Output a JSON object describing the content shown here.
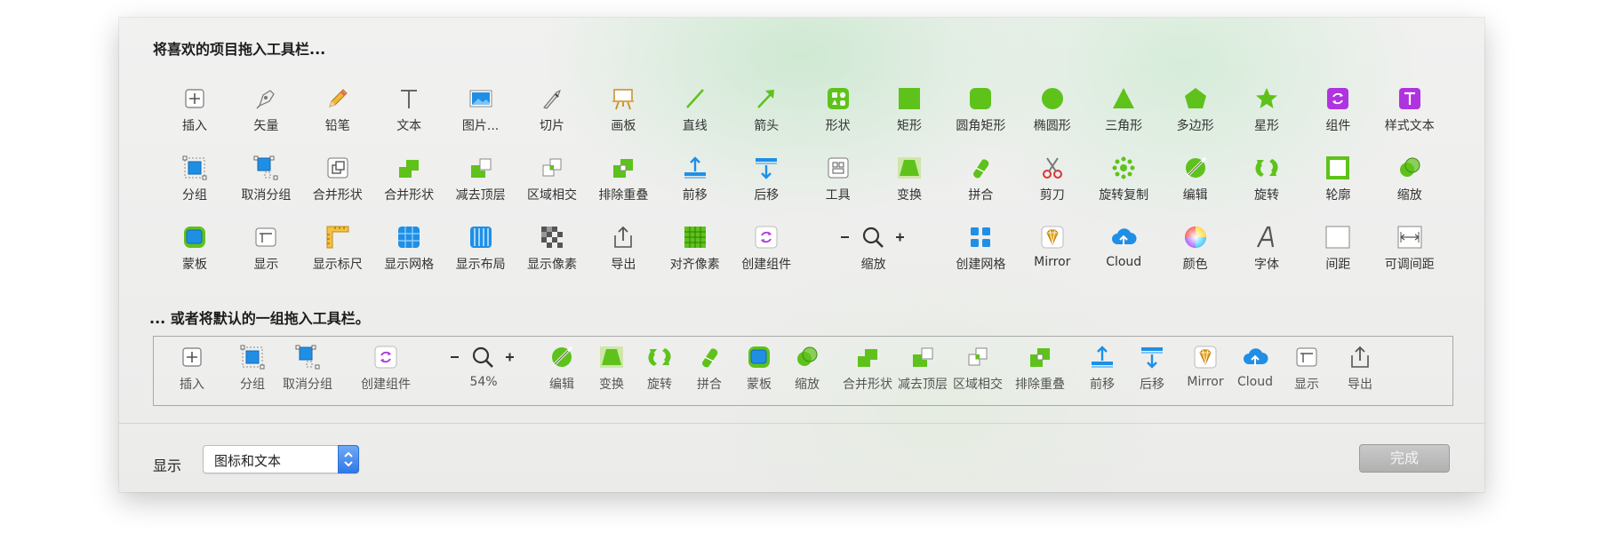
{
  "sheet": {
    "drag_items_heading": "将喜欢的项目拖入工具栏...",
    "default_set_heading": "... 或者将默认的一组拖入工具栏。"
  },
  "palette_rows": [
    [
      {
        "label": "插入",
        "icon": "insert-plus-icon"
      },
      {
        "label": "矢量",
        "icon": "vector-pen-icon"
      },
      {
        "label": "铅笔",
        "icon": "pencil-icon"
      },
      {
        "label": "文本",
        "icon": "text-icon"
      },
      {
        "label": "图片...",
        "icon": "image-icon"
      },
      {
        "label": "切片",
        "icon": "slice-knife-icon"
      },
      {
        "label": "画板",
        "icon": "artboard-easel-icon"
      },
      {
        "label": "直线",
        "icon": "line-icon"
      },
      {
        "label": "箭头",
        "icon": "arrow-icon"
      },
      {
        "label": "形状",
        "icon": "shapes-icon"
      },
      {
        "label": "矩形",
        "icon": "rectangle-icon"
      },
      {
        "label": "圆角矩形",
        "icon": "rounded-rectangle-icon"
      },
      {
        "label": "椭圆形",
        "icon": "oval-icon"
      },
      {
        "label": "三角形",
        "icon": "triangle-icon"
      },
      {
        "label": "多边形",
        "icon": "polygon-icon"
      },
      {
        "label": "星形",
        "icon": "star-icon"
      },
      {
        "label": "组件",
        "icon": "symbol-icon"
      },
      {
        "label": "样式文本",
        "icon": "text-style-icon"
      }
    ],
    [
      {
        "label": "分组",
        "icon": "group-icon"
      },
      {
        "label": "取消分组",
        "icon": "ungroup-icon"
      },
      {
        "label": "合并形状",
        "icon": "combine-shape-icon"
      },
      {
        "label": "合并形状",
        "icon": "union-icon"
      },
      {
        "label": "减去顶层",
        "icon": "subtract-icon"
      },
      {
        "label": "区域相交",
        "icon": "intersect-icon"
      },
      {
        "label": "排除重叠",
        "icon": "difference-icon"
      },
      {
        "label": "前移",
        "icon": "move-forward-icon"
      },
      {
        "label": "后移",
        "icon": "move-backward-icon"
      },
      {
        "label": "工具",
        "icon": "tools-icon"
      },
      {
        "label": "变换",
        "icon": "transform-icon"
      },
      {
        "label": "拼合",
        "icon": "flatten-icon"
      },
      {
        "label": "剪刀",
        "icon": "scissors-icon"
      },
      {
        "label": "旋转复制",
        "icon": "rotate-copies-icon"
      },
      {
        "label": "编辑",
        "icon": "edit-icon"
      },
      {
        "label": "旋转",
        "icon": "rotate-icon"
      },
      {
        "label": "轮廓",
        "icon": "outline-icon"
      },
      {
        "label": "缩放",
        "icon": "scale-icon"
      }
    ],
    [
      {
        "label": "蒙板",
        "icon": "mask-icon"
      },
      {
        "label": "显示",
        "icon": "view-icon"
      },
      {
        "label": "显示标尺",
        "icon": "rulers-icon"
      },
      {
        "label": "显示网格",
        "icon": "grid-icon"
      },
      {
        "label": "显示布局",
        "icon": "layout-icon"
      },
      {
        "label": "显示像素",
        "icon": "pixels-icon"
      },
      {
        "label": "导出",
        "icon": "export-icon"
      },
      {
        "label": "对齐像素",
        "icon": "pixel-align-icon"
      },
      {
        "label": "创建组件",
        "icon": "create-symbol-icon"
      },
      {
        "label": "缩放",
        "icon": "zoom-icon",
        "zoom": true
      },
      {
        "label": "创建网格",
        "icon": "make-grid-icon"
      },
      {
        "label": "Mirror",
        "icon": "mirror-icon"
      },
      {
        "label": "Cloud",
        "icon": "cloud-icon"
      },
      {
        "label": "颜色",
        "icon": "colors-icon"
      },
      {
        "label": "字体",
        "icon": "fonts-icon"
      },
      {
        "label": "间距",
        "icon": "space-icon"
      },
      {
        "label": "可调间距",
        "icon": "flexible-space-icon"
      }
    ]
  ],
  "default_set": [
    {
      "label": "插入",
      "icon": "insert-plus-icon"
    },
    {
      "label": "分组",
      "icon": "group-icon"
    },
    {
      "label": "取消分组",
      "icon": "ungroup-icon"
    },
    {
      "label": "创建组件",
      "icon": "create-symbol-icon"
    },
    {
      "label": "54%",
      "icon": "zoom-icon",
      "zoom": true
    },
    {
      "label": "编辑",
      "icon": "edit-icon"
    },
    {
      "label": "变换",
      "icon": "transform-icon"
    },
    {
      "label": "旋转",
      "icon": "rotate-icon"
    },
    {
      "label": "拼合",
      "icon": "flatten-icon"
    },
    {
      "label": "蒙板",
      "icon": "mask-icon"
    },
    {
      "label": "缩放",
      "icon": "scale-icon"
    },
    {
      "label": "合并形状",
      "icon": "union-icon"
    },
    {
      "label": "减去顶层",
      "icon": "subtract-icon"
    },
    {
      "label": "区域相交",
      "icon": "intersect-icon"
    },
    {
      "label": "排除重叠",
      "icon": "difference-icon"
    },
    {
      "label": "前移",
      "icon": "move-forward-icon"
    },
    {
      "label": "后移",
      "icon": "move-backward-icon"
    },
    {
      "label": "Mirror",
      "icon": "mirror-icon"
    },
    {
      "label": "Cloud",
      "icon": "cloud-icon"
    },
    {
      "label": "显示",
      "icon": "view-icon"
    },
    {
      "label": "导出",
      "icon": "export-icon"
    }
  ],
  "footer": {
    "show_label": "显示",
    "show_select_value": "图标和文本",
    "done_label": "完成"
  },
  "colors": {
    "green": "#5ec21b",
    "purple": "#b033e0",
    "blue": "#1f8fe6",
    "gold": "#e6a51a"
  }
}
